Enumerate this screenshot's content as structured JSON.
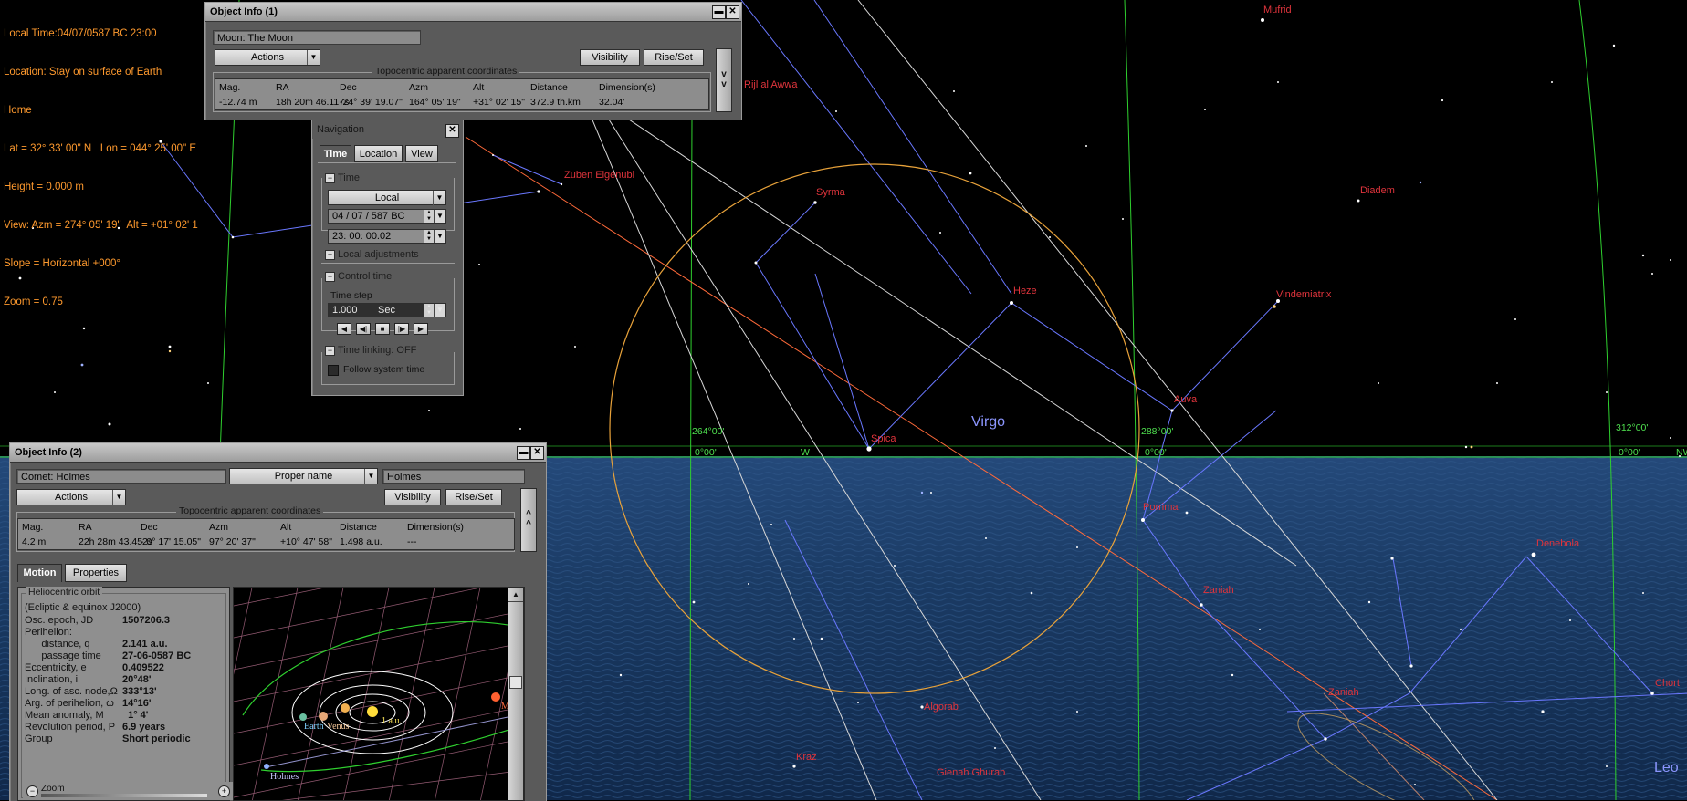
{
  "hud": {
    "local_time": "Local Time:04/07/0587 BC 23:00",
    "location": "Location: Stay on surface of Earth",
    "home": "Home",
    "latlon": "Lat = 32° 33' 00\" N   Lon = 044° 25' 00\" E",
    "height": "Height = 0.000 m",
    "view": "View: Azm = 274° 05' 19\"  Alt = +01° 02' 1",
    "slope": "Slope = Horizontal +000°",
    "zoom": "Zoom = 0.75"
  },
  "sky_labels": {
    "mufrid": "Mufrid",
    "rijl": "Rijl al Awwa",
    "zuben": "Zuben Elgenubi",
    "syrma": "Syrma",
    "diadem": "Diadem",
    "heze": "Heze",
    "vindemiatrix": "Vindemiatrix",
    "auva": "Auva",
    "virgo": "Virgo",
    "spica": "Spica",
    "porrima": "Porrima",
    "zaniah1": "Zaniah",
    "zaniah2": "Zaniah",
    "denebola": "Denebola",
    "chort": "Chort",
    "algorab": "Algorab",
    "kraz": "Kraz",
    "gienah": "Gienah Ghurab",
    "leo": "Leo",
    "az264": "264°00'",
    "az288": "288°00'",
    "az312": "312°00'",
    "alt0a": "0°00'",
    "alt0b": "0°00'",
    "alt0c": "0°00'",
    "west": "W",
    "nw": "NW"
  },
  "obj1": {
    "title": "Object Info (1)",
    "name": "Moon: The Moon",
    "actions": "Actions",
    "visibility": "Visibility",
    "riseset": "Rise/Set",
    "coords_title": "Topocentric apparent coordinates",
    "headers": [
      "Mag.",
      "RA",
      "Dec",
      "Azm",
      "Alt",
      "Distance",
      "Dimension(s)"
    ],
    "values": [
      "-12.74 m",
      "18h 20m 46.117s",
      "-24° 39' 19.07\"",
      "164° 05' 19\"",
      "+31° 02' 15\"",
      "372.9 th.km",
      "32.04'"
    ],
    "expand": "v v"
  },
  "nav": {
    "title": "Navigation",
    "tabs": [
      "Time",
      "Location",
      "View"
    ],
    "time_section": "Time",
    "time_mode": "Local",
    "date": "04 / 07 /  587    BC",
    "clock": "23:   00: 00.02",
    "local_adj": "Local adjustments",
    "control_time": "Control time",
    "time_step_label": "Time step",
    "time_step": "1.000",
    "time_unit": "Sec",
    "time_linking": "Time linking: OFF",
    "follow": "Follow system time"
  },
  "obj2": {
    "title": "Object Info (2)",
    "name": "Comet: Holmes",
    "name_mode": "Proper name",
    "name_value": "Holmes",
    "actions": "Actions",
    "visibility": "Visibility",
    "riseset": "Rise/Set",
    "coords_title": "Topocentric apparent coordinates",
    "headers": [
      "Mag.",
      "RA",
      "Dec",
      "Azm",
      "Alt",
      "Distance",
      "Dimension(s)"
    ],
    "values": [
      "4.2 m",
      "22h 28m 43.452s",
      "- 0° 17' 15.05\"",
      "97° 20' 37\"",
      "+10° 47' 58\"",
      "1.498 a.u.",
      "---"
    ],
    "collapse": "^ ^",
    "tabs": [
      "Motion",
      "Properties"
    ],
    "orbit_title": "Heliocentric orbit",
    "orbit_sub": "(Ecliptic & equinox J2000)",
    "orbit_rows": [
      {
        "label": "Osc. epoch, JD",
        "value": "1507206.3"
      },
      {
        "label": "Perihelion:",
        "value": ""
      },
      {
        "label": "      distance, q",
        "value": "2.141 a.u."
      },
      {
        "label": "      passage time",
        "value": "27-06-0587 BC"
      },
      {
        "label": "Eccentricity, e",
        "value": "0.409522"
      },
      {
        "label": "Inclination, i",
        "value": "20°48'"
      },
      {
        "label": "Long. of asc. node,Ω",
        "value": "333°13'"
      },
      {
        "label": "Arg. of perihelion, ω",
        "value": "14°16'"
      },
      {
        "label": "Mean anomaly, M",
        "value": "  1° 4'"
      },
      {
        "label": "Revolution period, P",
        "value": "6.9 years"
      },
      {
        "label": "Group",
        "value": "Short periodic"
      }
    ],
    "zoom_label": "Zoom",
    "orbit_labels": {
      "earth": "Earth",
      "venus": "Venus",
      "sun": "1 a.u.",
      "mars": "Ma",
      "holmes": "Holmes"
    }
  },
  "colors": {
    "sky": "#000000",
    "sea": "#1a3a63",
    "star_label": "#e0343c",
    "grid": "#2fd02f",
    "constellation": "#6a78ff",
    "ecliptic": "#ff6a3a",
    "moon_circle": "#e8a23a",
    "hud": "#ff9a2e"
  }
}
